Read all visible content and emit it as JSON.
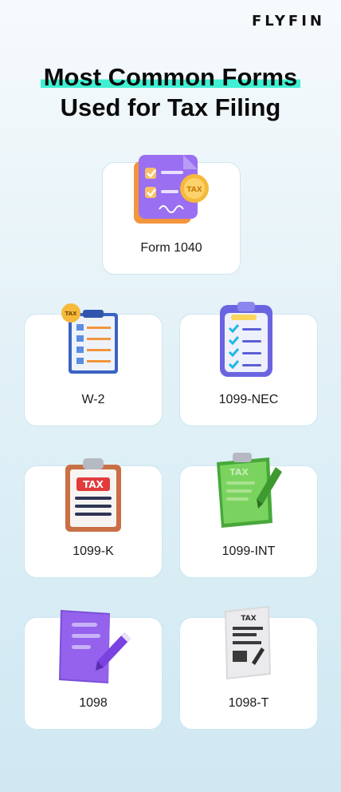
{
  "brand": "FLYFIN",
  "title": {
    "line1": "Most Common Forms",
    "line2": "Used for Tax Filing"
  },
  "forms": [
    {
      "label": "Form 1040",
      "icon": "stacked-documents-tax-coin-icon",
      "badge": "TAX"
    },
    {
      "label": "W-2",
      "icon": "clipboard-checklist-tax-badge-icon",
      "badge": "TAX"
    },
    {
      "label": "1099-NEC",
      "icon": "clipboard-checkmarks-icon"
    },
    {
      "label": "1099-K",
      "icon": "clipboard-tax-header-icon",
      "badge": "TAX"
    },
    {
      "label": "1099-INT",
      "icon": "green-tax-clipboard-pen-icon",
      "badge": "TAX"
    },
    {
      "label": "1098",
      "icon": "purple-document-pen-icon"
    },
    {
      "label": "1098-T",
      "icon": "gray-tax-document-pen-icon",
      "badge": "TAX"
    }
  ],
  "colors": {
    "highlight": "#3ff0d2",
    "purple": "#8b5cf6",
    "orange": "#f59e42",
    "green": "#5cc24a",
    "red": "#e53e3e"
  }
}
